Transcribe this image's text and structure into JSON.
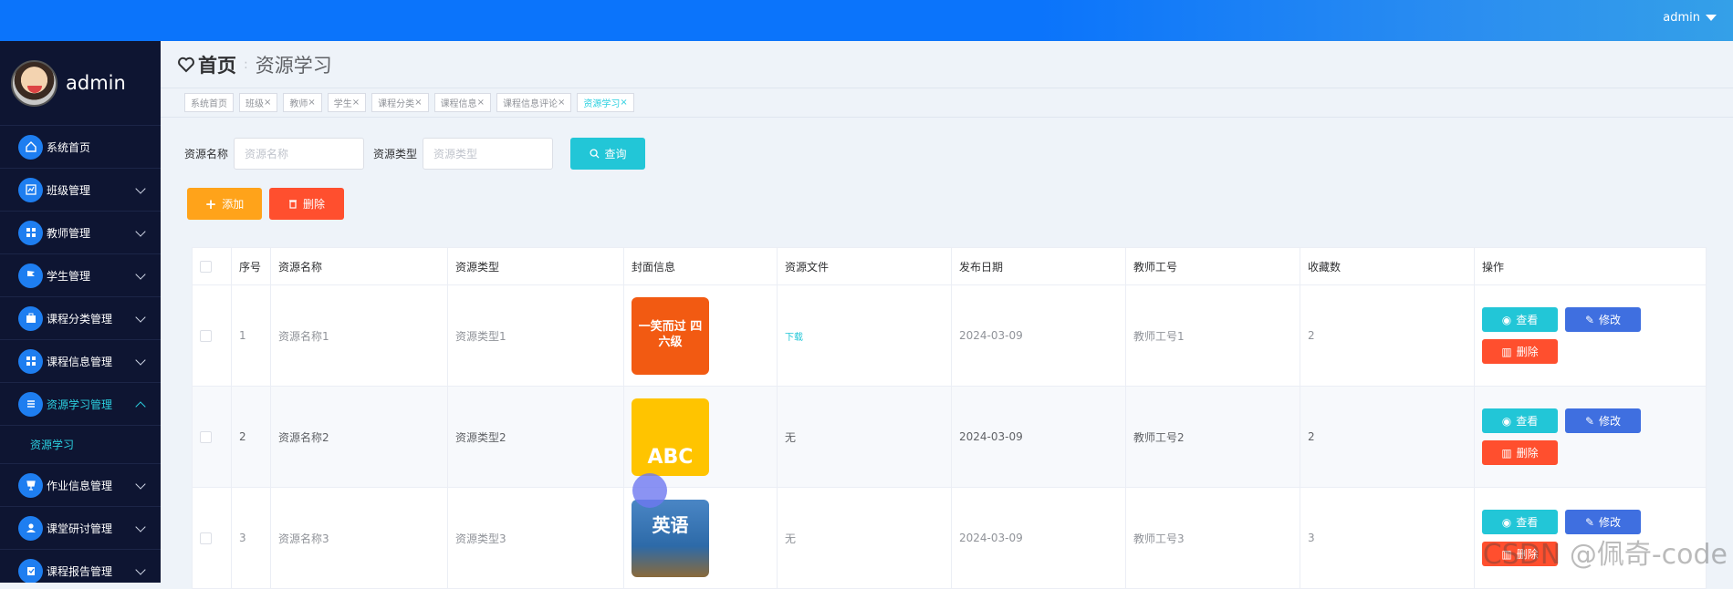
{
  "topbar": {
    "user": "admin"
  },
  "sidebar": {
    "profile_name": "admin",
    "items": [
      {
        "label": "系统首页",
        "icon": "home-icon"
      },
      {
        "label": "班级管理",
        "icon": "chart-icon"
      },
      {
        "label": "教师管理",
        "icon": "grid-icon"
      },
      {
        "label": "学生管理",
        "icon": "flag-icon"
      },
      {
        "label": "课程分类管理",
        "icon": "briefcase-icon"
      },
      {
        "label": "课程信息管理",
        "icon": "grid-icon"
      },
      {
        "label": "资源学习管理",
        "icon": "list-icon"
      },
      {
        "label": "作业信息管理",
        "icon": "cup-icon"
      },
      {
        "label": "课堂研讨管理",
        "icon": "user-icon"
      },
      {
        "label": "课程报告管理",
        "icon": "clipboard-icon"
      }
    ],
    "submenu": "资源学习"
  },
  "breadcrumb": {
    "home": "首页",
    "current": "资源学习"
  },
  "tags": [
    "系统首页",
    "班级",
    "教师",
    "学生",
    "课程分类",
    "课程信息",
    "课程信息评论",
    "资源学习"
  ],
  "search": {
    "name_label": "资源名称",
    "name_placeholder": "资源名称",
    "type_label": "资源类型",
    "type_placeholder": "资源类型",
    "query_label": "查询"
  },
  "actions": {
    "add": "添加",
    "delete": "删除"
  },
  "table": {
    "headers": [
      "序号",
      "资源名称",
      "资源类型",
      "封面信息",
      "资源文件",
      "发布日期",
      "教师工号",
      "收藏数",
      "操作"
    ],
    "rows": [
      {
        "index": "1",
        "name": "资源名称1",
        "type": "资源类型1",
        "cover_text": "一笑而过 四六级",
        "file": "下载",
        "date": "2024-03-09",
        "teacher": "教师工号1",
        "favs": "2"
      },
      {
        "index": "2",
        "name": "资源名称2",
        "type": "资源类型2",
        "cover_text": "ABC",
        "file": "无",
        "date": "2024-03-09",
        "teacher": "教师工号2",
        "favs": "2"
      },
      {
        "index": "3",
        "name": "资源名称3",
        "type": "资源类型3",
        "cover_text": "英语",
        "file": "无",
        "date": "2024-03-09",
        "teacher": "教师工号3",
        "favs": "3"
      }
    ],
    "ops": {
      "view": "查看",
      "edit": "修改",
      "delete": "删除"
    }
  },
  "watermark": "CSDN @佩奇-code"
}
